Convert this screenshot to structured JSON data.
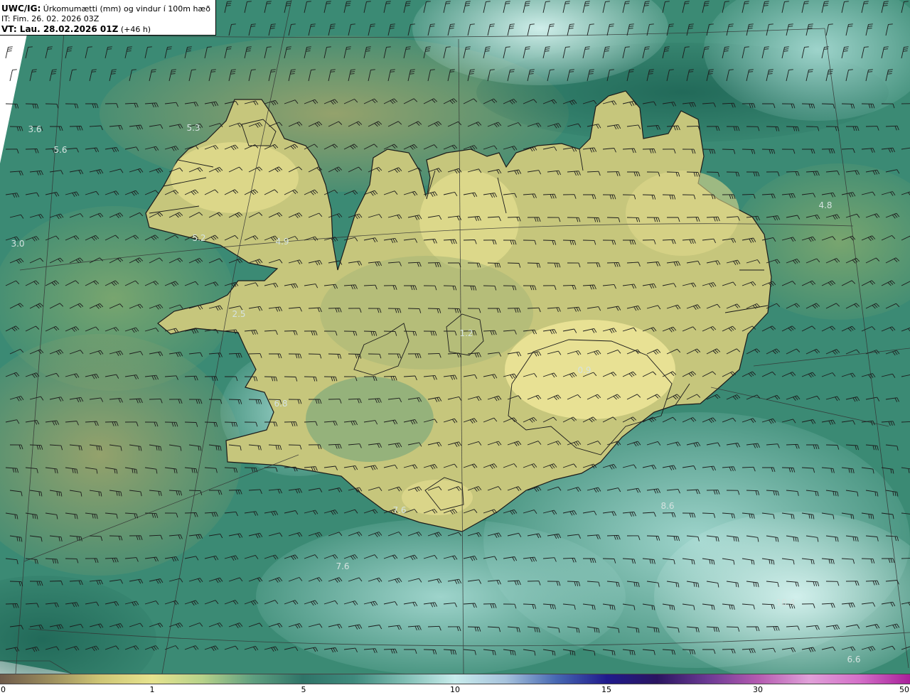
{
  "title": {
    "model": "UWC/IG:",
    "description": "Úrkomumætti (mm) og vindur í 100m hæð",
    "init_time": "IT: Fim. 26. 02. 2026 03Z",
    "valid_time": "VT: Lau. 28.02.2026 01Z",
    "lead_time": "(+46 h)"
  },
  "value_labels": [
    "3.6",
    "5.6",
    "5.3",
    "3.0",
    "5.2",
    "4.9",
    "2.5",
    "6.8",
    "1.2",
    "0.9",
    "4.8",
    "7.6",
    "7.6",
    "8.6",
    "10.4",
    "6.6"
  ],
  "colorbar": {
    "ticks": [
      "0",
      "1",
      "5",
      "10",
      "15",
      "30",
      "50"
    ],
    "colors": [
      "#6e5a4a",
      "#9c8e5d",
      "#cfc675",
      "#e6e38e",
      "#b7d28a",
      "#5f9f80",
      "#2f7468",
      "#3f8a7d",
      "#7fbdb3",
      "#c8ecec",
      "#a6c2dc",
      "#4768b2",
      "#201a8c",
      "#2a1560",
      "#6c3a94",
      "#b45ab0",
      "#e0a0d8",
      "#d470c8",
      "#a8209a"
    ]
  },
  "colors": {
    "land_fill": "#c6c67c",
    "sea_fill": "#3b8a74",
    "coast": "#1a1a1a",
    "barb": "#1c1c1c",
    "label": "#d5e3e0"
  }
}
